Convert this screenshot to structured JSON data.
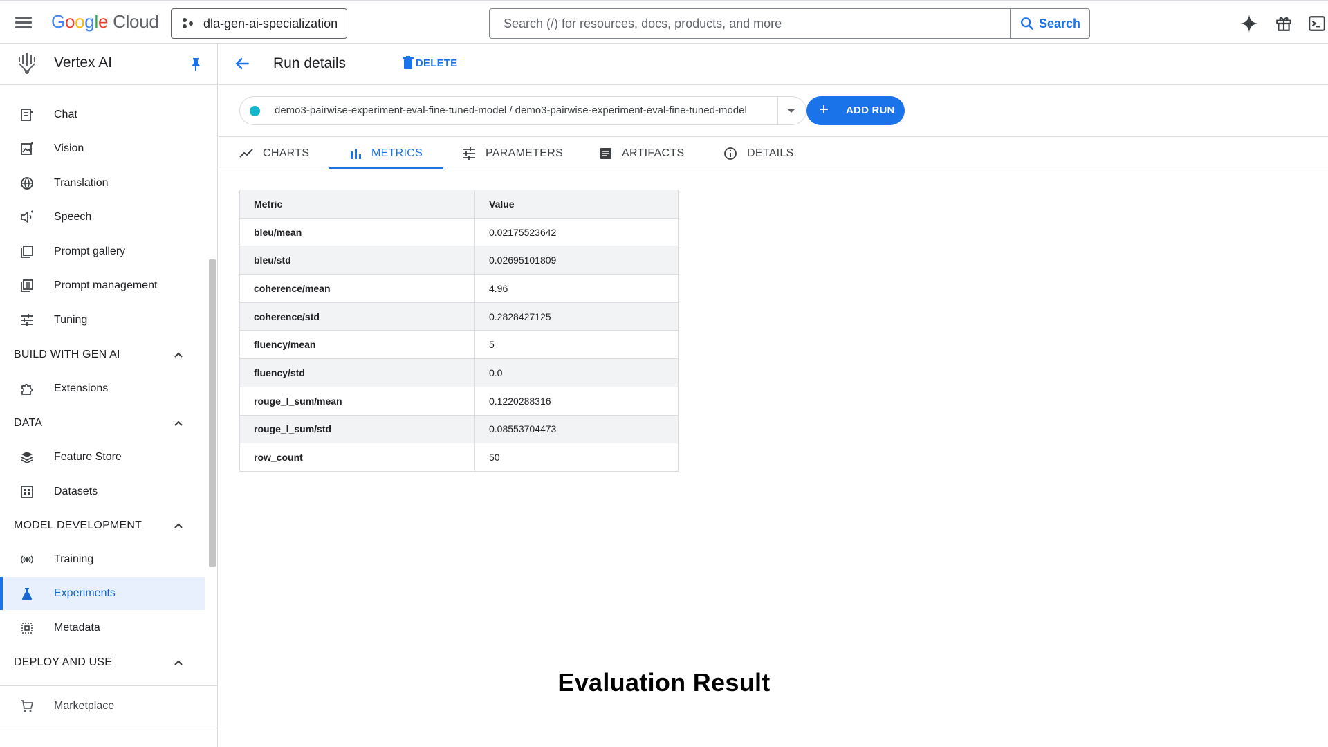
{
  "topbar": {
    "logo_letters": [
      "G",
      "o",
      "o",
      "g",
      "l",
      "e"
    ],
    "logo_suffix": "Cloud",
    "project": "dla-gen-ai-specialization",
    "search_placeholder": "Search (/) for resources, docs, products, and more",
    "search_button": "Search"
  },
  "sidebar": {
    "title": "Vertex AI",
    "items": [
      {
        "label": "Chat",
        "icon": "chat-icon"
      },
      {
        "label": "Vision",
        "icon": "image-icon"
      },
      {
        "label": "Translation",
        "icon": "globe-icon"
      },
      {
        "label": "Speech",
        "icon": "speaker-icon"
      },
      {
        "label": "Prompt gallery",
        "icon": "gallery-icon"
      },
      {
        "label": "Prompt management",
        "icon": "list-icon"
      },
      {
        "label": "Tuning",
        "icon": "sliders-icon"
      }
    ],
    "section_build": "BUILD WITH GEN AI",
    "build_items": [
      {
        "label": "Extensions",
        "icon": "puzzle-icon"
      }
    ],
    "section_data": "DATA",
    "data_items": [
      {
        "label": "Feature Store",
        "icon": "layers-icon"
      },
      {
        "label": "Datasets",
        "icon": "grid-icon"
      }
    ],
    "section_model": "MODEL DEVELOPMENT",
    "model_items": [
      {
        "label": "Training",
        "icon": "training-icon"
      },
      {
        "label": "Experiments",
        "icon": "flask-icon",
        "active": true
      },
      {
        "label": "Metadata",
        "icon": "metadata-icon"
      }
    ],
    "section_deploy": "DEPLOY AND USE",
    "deploy_items": [
      {
        "label": "Marketplace",
        "icon": "cart-icon"
      }
    ]
  },
  "header": {
    "title": "Run details",
    "delete_label": "DELETE"
  },
  "run": {
    "name": "demo3-pairwise-experiment-eval-fine-tuned-model / demo3-pairwise-experiment-eval-fine-tuned-model",
    "add_run_label": "ADD RUN",
    "dot_color": "#12b5cb"
  },
  "tabs": [
    {
      "label": "CHARTS",
      "icon": "chart-line-icon"
    },
    {
      "label": "METRICS",
      "icon": "bar-chart-icon",
      "active": true
    },
    {
      "label": "PARAMETERS",
      "icon": "tune-icon"
    },
    {
      "label": "ARTIFACTS",
      "icon": "document-icon"
    },
    {
      "label": "DETAILS",
      "icon": "info-icon"
    }
  ],
  "metrics": {
    "headers": [
      "Metric",
      "Value"
    ],
    "rows": [
      [
        "bleu/mean",
        "0.02175523642"
      ],
      [
        "bleu/std",
        "0.02695101809"
      ],
      [
        "coherence/mean",
        "4.96"
      ],
      [
        "coherence/std",
        "0.2828427125"
      ],
      [
        "fluency/mean",
        "5"
      ],
      [
        "fluency/std",
        "0.0"
      ],
      [
        "rouge_l_sum/mean",
        "0.1220288316"
      ],
      [
        "rouge_l_sum/std",
        "0.08553704473"
      ],
      [
        "row_count",
        "50"
      ]
    ]
  },
  "caption": "Evaluation Result",
  "colors": {
    "accent": "#1a73e8",
    "active_bg": "#e8f0fe"
  }
}
